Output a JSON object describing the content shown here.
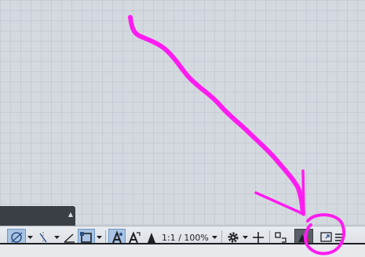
{
  "statusbar": {
    "scale_label": "1:1 / 100%"
  },
  "icons": [
    "object-snap-tracking-icon",
    "polar-tracking-icon",
    "isodraft-icon",
    "object-snap-icon",
    "annotation-visibility-icon",
    "auto-scale-icon",
    "annotation-scale-icon",
    "gear-icon",
    "plus-icon",
    "quick-properties-icon",
    "graphics-performance-icon",
    "clean-screen-icon",
    "menu-icon"
  ],
  "colors": {
    "annotation_stroke": "#ff1cf0",
    "active_button": "#a9c3e2"
  }
}
